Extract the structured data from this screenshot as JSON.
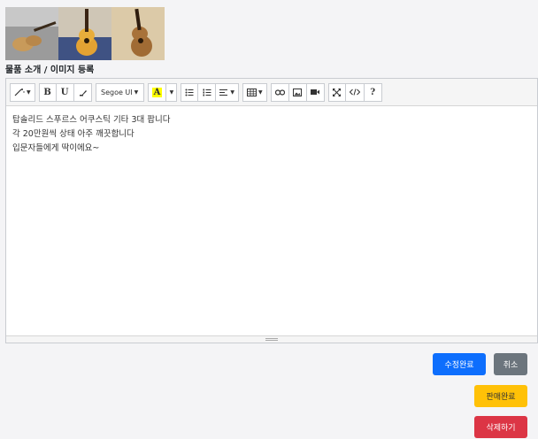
{
  "section_title": "물품 소개 / 이미지 등록",
  "toolbar": {
    "magic_label": "✨",
    "bold_label": "B",
    "underline_label": "U",
    "eraser_label": "⌫",
    "font_name": "Segoe UI",
    "color_label": "A",
    "help_label": "?"
  },
  "content": {
    "lines": [
      "탑솔리드 스푸르스 어쿠스틱 기타 3대 팝니다",
      "각 20만원씩 상태 아주 깨끗합니다",
      "입문자들에게 딱이에요~"
    ]
  },
  "buttons": {
    "edit": "수정완료",
    "cancel": "취소",
    "sold": "판매완료",
    "delete": "삭제하기"
  },
  "colors": {
    "primary": "#0d6efd",
    "secondary": "#6c757d",
    "warning": "#ffc107",
    "danger": "#dc3545",
    "highlight": "#ffff00"
  }
}
